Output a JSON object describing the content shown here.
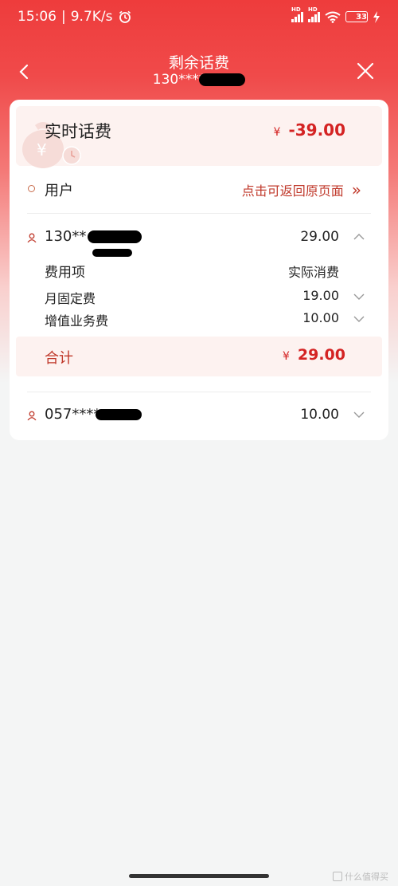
{
  "status_bar": {
    "time": "15:06",
    "net_speed": "9.7K/s",
    "sim1_label": "HD",
    "sim2_label": "HD",
    "battery_level": "33"
  },
  "nav": {
    "title": "剩余话费",
    "subtitle_number": "130****"
  },
  "summary": {
    "label": "实时话费",
    "currency": "¥",
    "amount": "-39.00",
    "icon_glyph": "¥"
  },
  "user_row": {
    "label": "用户",
    "return_link": "点击可返回原页面",
    "return_arrow": "»"
  },
  "accounts": [
    {
      "number": "130**",
      "amount": "29.00",
      "expanded": true,
      "fee_header": {
        "name": "费用项",
        "value": "实际消费"
      },
      "fees": [
        {
          "name": "月固定费",
          "value": "19.00"
        },
        {
          "name": "增值业务费",
          "value": "10.00"
        }
      ],
      "total": {
        "label": "合计",
        "currency": "¥",
        "amount": "29.00"
      }
    },
    {
      "number": "057****",
      "amount": "10.00",
      "expanded": false
    }
  ],
  "watermark": "什么值得买",
  "colors": {
    "accent_red": "#d42323",
    "header_red": "#ee3c3c",
    "highlight_bg": "#fdf2f0",
    "battery_green": "#7ed957"
  }
}
